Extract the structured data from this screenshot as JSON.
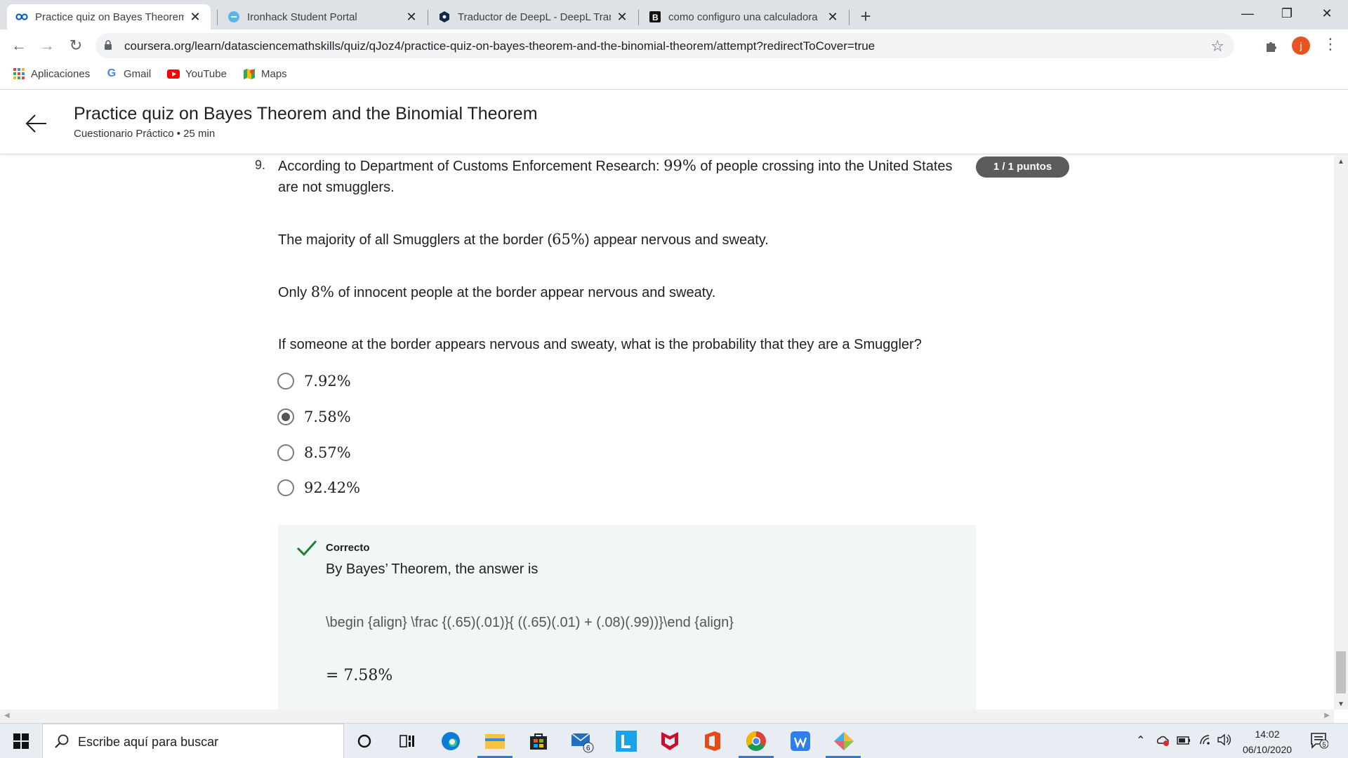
{
  "browser": {
    "tabs": [
      {
        "title": "Practice quiz on Bayes Theorem a",
        "active": true,
        "favicon": "coursera-icon"
      },
      {
        "title": "Ironhack Student Portal",
        "active": false,
        "favicon": "ironhack-icon"
      },
      {
        "title": "Traductor de DeepL - DeepL Tran",
        "active": false,
        "favicon": "deepl-icon"
      },
      {
        "title": "como configuro una calculadora",
        "active": false,
        "favicon": "bing-icon"
      }
    ],
    "close_glyph": "✕",
    "new_tab_glyph": "+",
    "url": "coursera.org/learn/datasciencemathskills/quiz/qJoz4/practice-quiz-on-bayes-theorem-and-the-binomial-theorem/attempt?redirectToCover=true",
    "avatar_letter": "j",
    "window_controls": {
      "minimize": "—",
      "restore": "❐",
      "close": "✕"
    },
    "bookmarks": [
      {
        "label": "Aplicaciones",
        "icon": "apps-grid-icon"
      },
      {
        "label": "Gmail",
        "icon": "google-icon"
      },
      {
        "label": "YouTube",
        "icon": "youtube-icon"
      },
      {
        "label": "Maps",
        "icon": "maps-icon"
      }
    ]
  },
  "course_header": {
    "title": "Practice quiz on Bayes Theorem and the Binomial Theorem",
    "subtitle": "Cuestionario Práctico • 25 min"
  },
  "question": {
    "number": "9.",
    "points": "1 / 1 puntos",
    "paragraphs": [
      {
        "before": "According to Department of Customs Enforcement Research: ",
        "math": "99%",
        "after": " of people crossing into the United States are not smugglers."
      },
      {
        "before": "The majority of all Smugglers at the border (",
        "math": "65%",
        "after": ") appear nervous and sweaty."
      },
      {
        "before": "Only ",
        "math": "8%",
        "after": " of innocent people at the border appear nervous and sweaty."
      }
    ],
    "prompt": "If someone at the border appears nervous and sweaty, what is the probability that they are a Smuggler?",
    "options": [
      {
        "label": "7.92%",
        "selected": false
      },
      {
        "label": "7.58%",
        "selected": true
      },
      {
        "label": "8.57%",
        "selected": false
      },
      {
        "label": "92.42%",
        "selected": false
      }
    ]
  },
  "feedback": {
    "status": "Correcto",
    "text": "By Bayes’ Theorem, the answer is",
    "latex": "\\begin {align} \\frac {(.65)(.01)}{ ((.65)(.01) + (.08)(.99))}\\end {align}",
    "result": "= 7.58%"
  },
  "colors": {
    "points_badge": "#5b5b5b",
    "feedback_bg": "#f1f7f4",
    "check": "#1e7e34",
    "tab_strip": "#dee1e6"
  },
  "taskbar": {
    "search_placeholder": "Escribe aquí para buscar",
    "mail_badge": "6",
    "time": "14:02",
    "date": "06/10/2020",
    "notification_count": "5"
  }
}
